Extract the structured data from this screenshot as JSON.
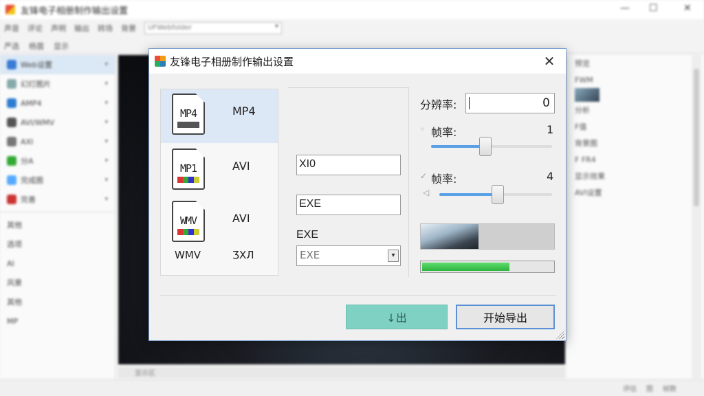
{
  "background": {
    "window_title": "友锋电子相册制作输出设置",
    "window_controls": [
      "—",
      "☐",
      "✕"
    ],
    "menu": [
      "声音",
      "评论",
      "声明",
      "输出",
      "转场",
      "背景"
    ],
    "combo_value": "UFWebfolder",
    "toolbar": [
      "严选",
      "杨茵",
      "显示"
    ],
    "left_items": [
      {
        "label": "Web设置",
        "selected": true,
        "color": "#3a7bd5"
      },
      {
        "label": "幻灯图片",
        "selected": false,
        "color": "#8aa"
      },
      {
        "label": "AMP4",
        "selected": false,
        "color": "#2e7dd1"
      },
      {
        "label": "AVI/WMV",
        "selected": false,
        "color": "#555"
      },
      {
        "label": "AXI",
        "selected": false,
        "color": "#777"
      },
      {
        "label": "分A",
        "selected": false,
        "color": "#3a3"
      },
      {
        "label": "完成图",
        "selected": false,
        "color": "#5af"
      },
      {
        "label": "完善",
        "selected": false,
        "color": "#c33"
      }
    ],
    "left_items2": [
      "其他",
      "选项",
      "AI",
      "风景",
      "其他",
      "MP"
    ],
    "right_items": [
      "预览",
      "FWM",
      "分析",
      "F值",
      "背景图",
      "F FR4",
      "显示效果",
      "AVI设置"
    ],
    "hscroll_label": "显示区",
    "status": [
      "评估",
      "图",
      "帧数"
    ]
  },
  "dialog": {
    "title": "友锋电子相册制作输出设置",
    "close_label": "✕",
    "formats": [
      {
        "icon_text": "MP4",
        "label": "MP4",
        "selected": true
      },
      {
        "icon_text": "MP1",
        "label": "AVI",
        "selected": false
      },
      {
        "icon_text": "WMV",
        "label": "AVI",
        "selected": false
      }
    ],
    "format_bottom_left": "WMV",
    "format_bottom_right": "ƷXЛ",
    "field1_value": "XI0",
    "field2_value": "EXE",
    "field3_label": "EXE",
    "select_value": "EXE",
    "resolution_label": "分辨率:",
    "resolution_value": "0",
    "framerate1_label": "帧率:",
    "framerate1_value": "1",
    "framerate1_level": 0.45,
    "framerate2_label": "帧率:",
    "framerate2_value": "4",
    "framerate2_level": 0.52,
    "progress": 0.66,
    "export_label": "↓出",
    "start_label": "开始导出"
  }
}
